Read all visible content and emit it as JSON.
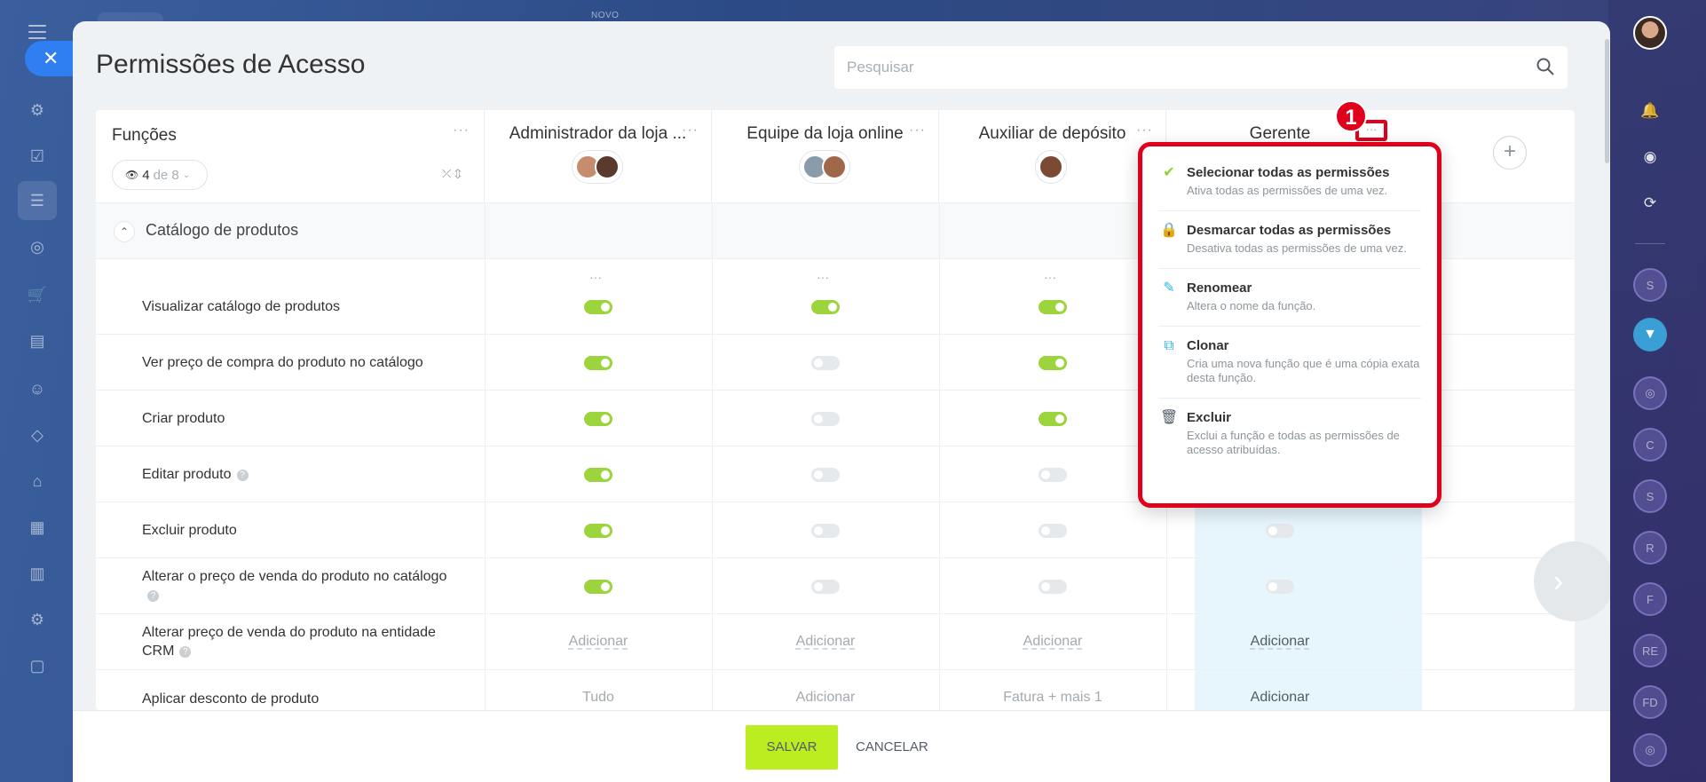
{
  "top": {
    "novo": "NOVO"
  },
  "title": "Permissões de Acesso",
  "search": {
    "placeholder": "Pesquisar"
  },
  "header": {
    "funcoes": "Funções",
    "counter": {
      "shown": "4",
      "total": "de 8"
    },
    "columns": [
      {
        "label": "Administrador da loja ..."
      },
      {
        "label": "Equipe da loja online"
      },
      {
        "label": "Auxiliar de depósito"
      },
      {
        "label": "Gerente"
      }
    ],
    "dots": "···"
  },
  "section": {
    "label": "Catálogo de produtos"
  },
  "rows": [
    {
      "label": "Visualizar catálogo de produtos",
      "help": false,
      "values": [
        "on",
        "on",
        "on",
        ""
      ]
    },
    {
      "label": "Ver preço de compra do produto no catálogo",
      "help": false,
      "values": [
        "on",
        "off",
        "on",
        ""
      ]
    },
    {
      "label": "Criar produto",
      "help": false,
      "values": [
        "on",
        "off",
        "on",
        ""
      ]
    },
    {
      "label": "Editar produto",
      "help": true,
      "values": [
        "on",
        "off",
        "off",
        ""
      ]
    },
    {
      "label": "Excluir produto",
      "help": false,
      "values": [
        "on",
        "off",
        "off",
        "off"
      ]
    },
    {
      "label": "Alterar o preço de venda do produto no catálogo",
      "help": true,
      "values": [
        "on",
        "off",
        "off",
        "off"
      ]
    },
    {
      "label": "Alterar preço de venda do produto na entidade CRM",
      "help": true,
      "values": [
        "Adicionar",
        "Adicionar",
        "Adicionar",
        "Adicionar"
      ]
    },
    {
      "label": "Aplicar desconto de produto",
      "help": false,
      "values": [
        "Tudo",
        "Adicionar",
        "Fatura + mais 1",
        "Adicionar"
      ]
    }
  ],
  "dropdown": {
    "badge": "1",
    "items": [
      {
        "title": "Selecionar todas as permissões",
        "desc": "Ativa todas as permissões de uma vez.",
        "icon": "check-icon",
        "color": "#8fd12b"
      },
      {
        "title": "Desmarcar todas as permissões",
        "desc": "Desativa todas as permissões de uma vez.",
        "icon": "lock-icon",
        "color": "#f04a5e"
      },
      {
        "title": "Renomear",
        "desc": "Altera o nome da função.",
        "icon": "pencil-icon",
        "color": "#2fb4e8"
      },
      {
        "title": "Clonar",
        "desc": "Cria uma nova função que é uma cópia exata desta função.",
        "icon": "copy-icon",
        "color": "#2fb4e8"
      },
      {
        "title": "Excluir",
        "desc": "Exclui a função e todas as permissões de acesso atribuídas.",
        "icon": "trash-icon",
        "color": "#535c69"
      }
    ]
  },
  "footer": {
    "save": "SALVAR",
    "cancel": "CANCELAR"
  },
  "right_sidebar": {
    "letters": [
      "S",
      "C",
      "S",
      "R",
      "F",
      "RE",
      "FD"
    ]
  }
}
